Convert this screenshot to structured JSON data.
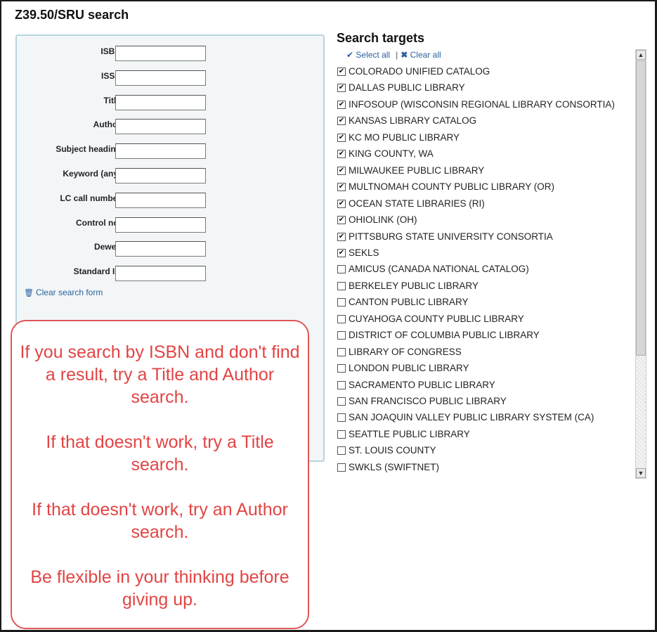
{
  "header": {
    "title": "Z39.50/SRU search"
  },
  "form": {
    "fields": [
      {
        "label": "ISBN:",
        "value": ""
      },
      {
        "label": "ISSN:",
        "value": ""
      },
      {
        "label": "Title:",
        "value": ""
      },
      {
        "label": "Author:",
        "value": ""
      },
      {
        "label": "Subject heading:",
        "value": ""
      },
      {
        "label": "Keyword (any):",
        "value": ""
      },
      {
        "label": "LC call number:",
        "value": ""
      },
      {
        "label": "Control no.:",
        "value": ""
      },
      {
        "label": "Dewey:",
        "value": ""
      },
      {
        "label": "Standard ID:",
        "value": ""
      }
    ],
    "clear_label": "Clear search form"
  },
  "callout": {
    "paragraphs": [
      "If you search by ISBN and don't find a result, try a Title and Author search.",
      "If that doesn't work, try a Title search.",
      "If that doesn't work, try an Author search.",
      "Be flexible in your thinking before giving up."
    ],
    "color": "#e24444"
  },
  "targets": {
    "title": "Search targets",
    "select_all": "Select all",
    "clear_all": "Clear all",
    "items": [
      {
        "label": "COLORADO UNIFIED CATALOG",
        "checked": true
      },
      {
        "label": "DALLAS PUBLIC LIBRARY",
        "checked": true
      },
      {
        "label": "INFOSOUP (WISCONSIN REGIONAL LIBRARY CONSORTIA)",
        "checked": true
      },
      {
        "label": "KANSAS LIBRARY CATALOG",
        "checked": true
      },
      {
        "label": "KC MO PUBLIC LIBRARY",
        "checked": true
      },
      {
        "label": "KING COUNTY, WA",
        "checked": true
      },
      {
        "label": "MILWAUKEE PUBLIC LIBRARY",
        "checked": true
      },
      {
        "label": "MULTNOMAH COUNTY PUBLIC LIBRARY (OR)",
        "checked": true
      },
      {
        "label": "OCEAN STATE LIBRARIES (RI)",
        "checked": true
      },
      {
        "label": "OHIOLINK (OH)",
        "checked": true
      },
      {
        "label": "PITTSBURG STATE UNIVERSITY CONSORTIA",
        "checked": true
      },
      {
        "label": "SEKLS",
        "checked": true
      },
      {
        "label": "AMICUS (CANADA NATIONAL CATALOG)",
        "checked": false
      },
      {
        "label": "BERKELEY PUBLIC LIBRARY",
        "checked": false
      },
      {
        "label": "CANTON PUBLIC LIBRARY",
        "checked": false
      },
      {
        "label": "CUYAHOGA COUNTY PUBLIC LIBRARY",
        "checked": false
      },
      {
        "label": "DISTRICT OF COLUMBIA PUBLIC LIBRARY",
        "checked": false
      },
      {
        "label": "LIBRARY OF CONGRESS",
        "checked": false
      },
      {
        "label": "LONDON PUBLIC LIBRARY",
        "checked": false
      },
      {
        "label": "SACRAMENTO PUBLIC LIBRARY",
        "checked": false
      },
      {
        "label": "SAN FRANCISCO PUBLIC LIBRARY",
        "checked": false
      },
      {
        "label": "SAN JOAQUIN VALLEY PUBLIC LIBRARY SYSTEM (CA)",
        "checked": false
      },
      {
        "label": "SEATTLE PUBLIC LIBRARY",
        "checked": false
      },
      {
        "label": "ST. LOUIS COUNTY",
        "checked": false
      },
      {
        "label": "SWKLS (SWIFTNET)",
        "checked": false
      }
    ]
  }
}
